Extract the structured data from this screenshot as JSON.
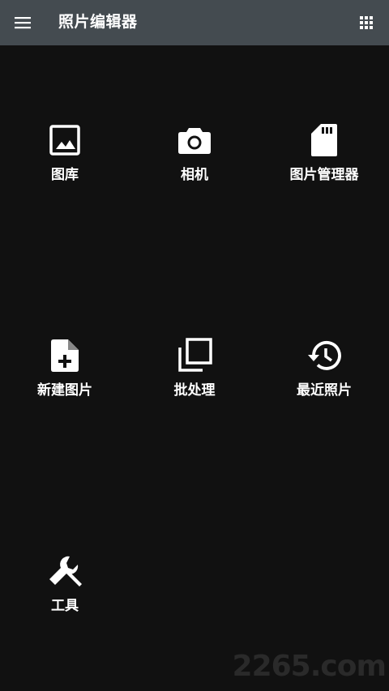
{
  "app": {
    "title": "照片编辑器"
  },
  "colors": {
    "appbar": "#444b50",
    "background": "#111111",
    "icon": "#ffffff"
  },
  "icons": {
    "menu": "hamburger-menu-icon",
    "apps": "apps-grid-icon"
  },
  "tiles": [
    {
      "label": "图库",
      "icon": "image-icon"
    },
    {
      "label": "相机",
      "icon": "camera-icon"
    },
    {
      "label": "图片管理器",
      "icon": "sd-card-icon"
    },
    {
      "label": "新建图片",
      "icon": "new-file-icon"
    },
    {
      "label": "批处理",
      "icon": "layers-icon"
    },
    {
      "label": "最近照片",
      "icon": "history-icon"
    },
    {
      "label": "工具",
      "icon": "wrench-icon"
    }
  ],
  "watermark": "2265.com"
}
